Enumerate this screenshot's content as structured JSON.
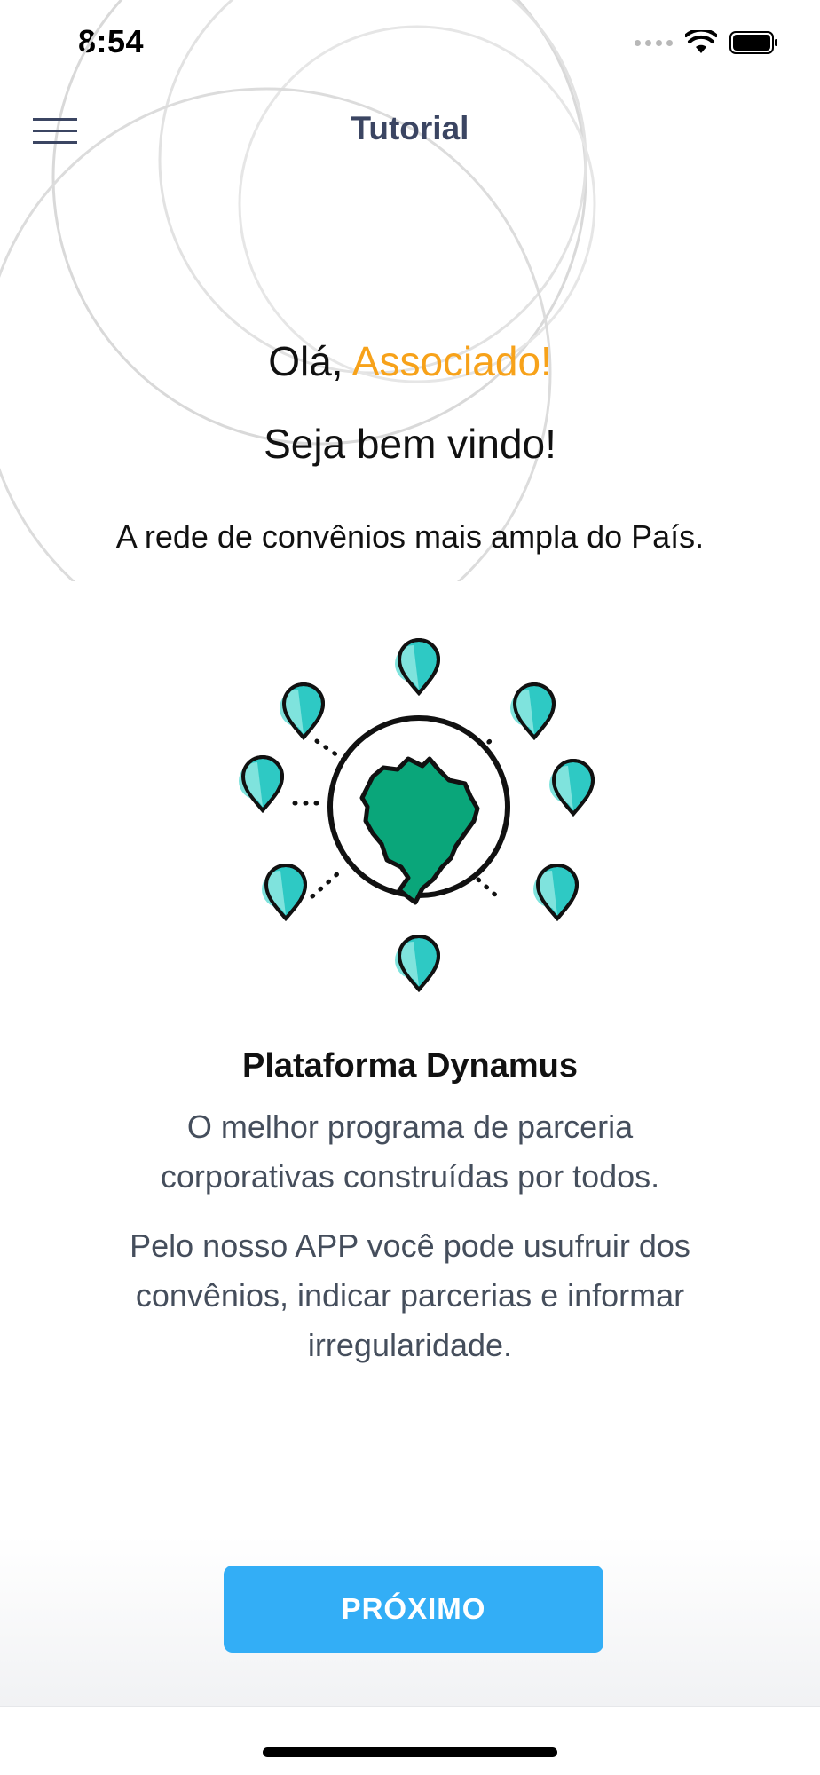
{
  "status_bar": {
    "time": "8:54"
  },
  "nav": {
    "title": "Tutorial",
    "menu_icon": "hamburger-menu-icon"
  },
  "content": {
    "greeting_prefix": "Olá, ",
    "greeting_name": "Associado!",
    "welcome": "Seja bem vindo!",
    "tagline": "A rede de convênios mais ampla do País.",
    "illustration_icon": "brazil-map-with-location-pins-icon",
    "feature_title": "Plataforma Dynamus",
    "feature_description": "O melhor programa de parceria corporativas construídas por todos.",
    "feature_details": "Pelo nosso APP você pode usufruir dos convênios, indicar parcerias e informar irregularidade."
  },
  "actions": {
    "next_label": "PRÓXIMO"
  },
  "colors": {
    "accent": "#f7a21a",
    "primary_button": "#33aef6",
    "nav_title": "#3b4562",
    "pin": "#2ec9c4",
    "map": "#0aa67a"
  }
}
